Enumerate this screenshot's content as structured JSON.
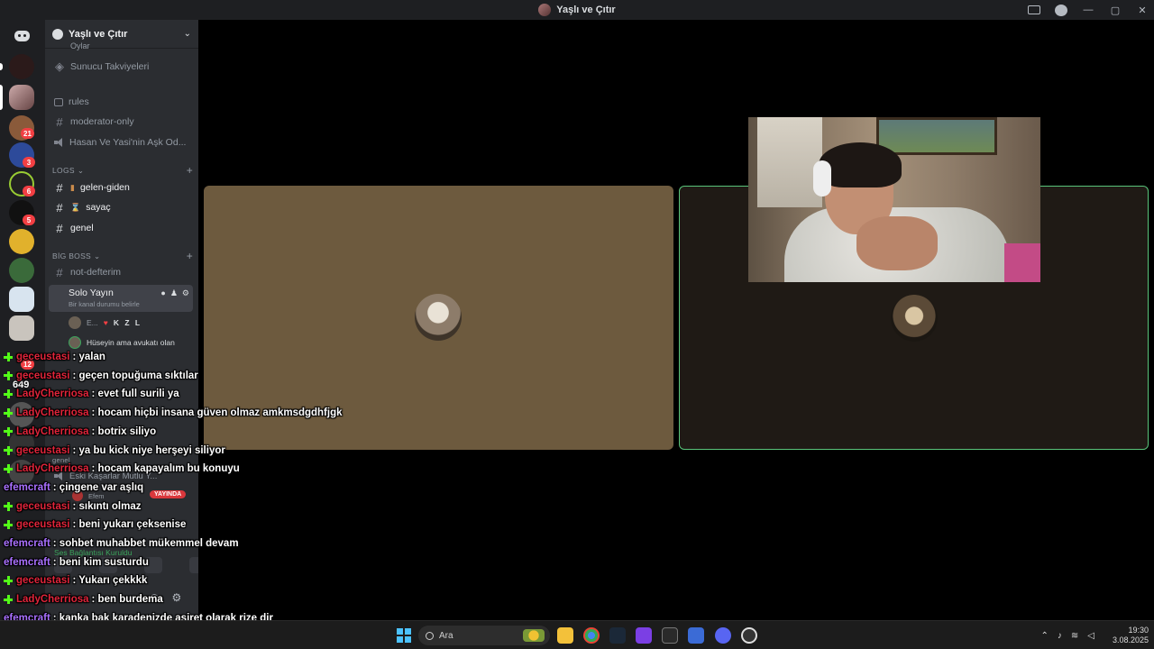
{
  "window": {
    "title": "Yaşlı ve Çıtır"
  },
  "rail": {
    "badges": [
      "21",
      "3",
      "6",
      "5",
      "12"
    ]
  },
  "guild": {
    "name": "Yaşlı ve Çıtır"
  },
  "channels": {
    "partial_top": "Oylar",
    "boosts": "Sunucu Takviyeleri",
    "rules": "rules",
    "moderator": "moderator-only",
    "hasan": "Hasan Ve Yasi'nin Aşk Od...",
    "logs_category": "LOGS",
    "gelen": "gelen-giden",
    "sayac": "sayaç",
    "genel": "genel",
    "bigboss_category": "BİG BOSS",
    "defter": "not-defterim",
    "solo": "Solo Yayın",
    "solo_status": "Bir kanal durumu belirle",
    "voice_user1": "E...",
    "voice_user1_tag": "K Z L",
    "voice_user2": "Hüseyin ama avukatı olan",
    "genel_small": "genel",
    "eski": "Eski Kaşarlar Mutlu Y...",
    "efem": "Efem",
    "live": "YAYINDA",
    "connection": "Ses Bağlantısı Kuruldu"
  },
  "overlay_count": "649",
  "chat": [
    {
      "user": "geceustasi",
      "color": "#e0243a",
      "text": ": yalan"
    },
    {
      "user": "geceustasi",
      "color": "#e0243a",
      "text": ": geçen topuğuma sıktılar"
    },
    {
      "user": "LadyCherriosa",
      "color": "#e0243a",
      "text": ": evet full surili ya"
    },
    {
      "user": "LadyCherriosa",
      "color": "#e0243a",
      "text": ": hocam hiçbi insana güven olmaz amkmsdgdhfjgk"
    },
    {
      "user": "LadyCherriosa",
      "color": "#e0243a",
      "text": ": botrix siliyo"
    },
    {
      "user": "geceustasi",
      "color": "#e0243a",
      "text": ": ya bu kick niye herşeyi siliyor"
    },
    {
      "user": "LadyCherriosa",
      "color": "#e0243a",
      "text": ": hocam kapayalım bu konuyu"
    },
    {
      "user": "efemcraft",
      "color": "#a970ff",
      "text": ": çingene var aşlıq"
    },
    {
      "user": "geceustasi",
      "color": "#e0243a",
      "text": ": sıkıntı olmaz"
    },
    {
      "user": "geceustasi",
      "color": "#e0243a",
      "text": ": beni yukarı çeksenise"
    },
    {
      "user": "efemcraft",
      "color": "#a970ff",
      "text": ": sohbet muhabbet mükemmel devam"
    },
    {
      "user": "efemcraft",
      "color": "#a970ff",
      "text": ": beni kim susturdu"
    },
    {
      "user": "geceustasi",
      "color": "#e0243a",
      "text": ": Yukarı çekkkk"
    },
    {
      "user": "LadyCherriosa",
      "color": "#e0243a",
      "text": ": ben burdema"
    },
    {
      "user": "efemcraft",
      "color": "#a970ff",
      "text": ": kanka bak karadenizde aşiret olarak rize dir"
    }
  ],
  "taskbar": {
    "search_placeholder": "Ara",
    "time": "19:30",
    "date": "3.08.2025"
  }
}
